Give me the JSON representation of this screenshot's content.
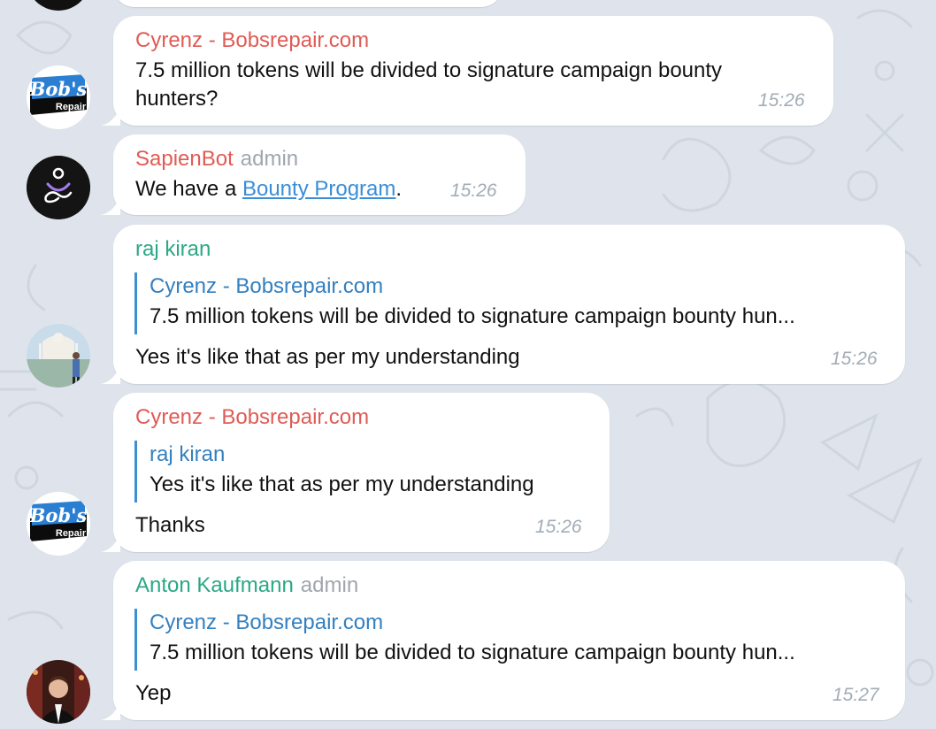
{
  "messages": [
    {
      "sender": "Cyrenz - Bobsrepair.com",
      "lines": [
        "7.5 million tokens will be divided to signature campaign bounty",
        "hunters?"
      ],
      "time": "15:26",
      "avatar": "bobs-repair-logo"
    },
    {
      "sender": "SapienBot",
      "role": "admin",
      "text_before": "We have a ",
      "link": "Bounty Program",
      "text_after": ".",
      "time": "15:26",
      "avatar": "sapien-bot-logo"
    },
    {
      "sender": "raj kiran",
      "reply": {
        "name": "Cyrenz - Bobsrepair.com",
        "text": "7.5 million tokens will be divided to signature campaign bounty hun..."
      },
      "text": "Yes it's like that as per my understanding",
      "time": "15:26",
      "avatar": "user-photo"
    },
    {
      "sender": "Cyrenz - Bobsrepair.com",
      "reply": {
        "name": "raj kiran",
        "text": "Yes it's like that as per my understanding"
      },
      "text": "Thanks",
      "time": "15:26",
      "avatar": "bobs-repair-logo"
    },
    {
      "sender": "Anton Kaufmann",
      "role": "admin",
      "reply": {
        "name": "Cyrenz - Bobsrepair.com",
        "text": "7.5 million tokens will be divided to signature campaign bounty hun..."
      },
      "text": "Yep",
      "time": "15:27",
      "avatar": "user-photo"
    }
  ],
  "logo": {
    "bobs": "Bob's",
    "repair": "Repair"
  },
  "colors": {
    "background": "#dfe4ec",
    "sender_red": "#e05b55",
    "sender_green": "#2ba885",
    "reply_blue": "#3380c0",
    "link": "#3a8ed6"
  }
}
